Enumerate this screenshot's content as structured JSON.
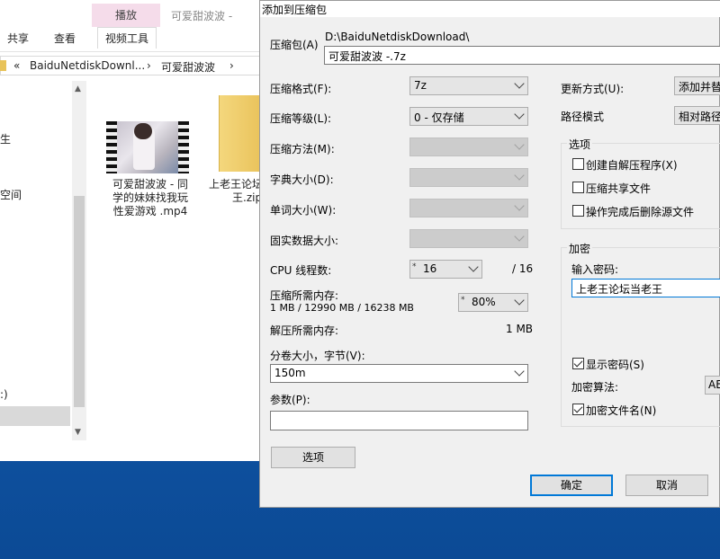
{
  "explorer": {
    "context_tab": "播放",
    "window_title": "可爱甜波波 -",
    "ribbon_tabs": [
      "共享",
      "查看",
      "视频工具"
    ],
    "breadcrumb": [
      "«",
      "BaiduNetdiskDownl...",
      "›",
      "可爱甜波波",
      "›"
    ],
    "nav_items": [
      "生",
      "空间",
      ":)"
    ],
    "files": [
      {
        "name_lines": [
          "可爱甜波波 - 同",
          "学的妹妹找我玩",
          "性爱游戏 .mp4"
        ]
      },
      {
        "name_lines": [
          "上老王论坛",
          "王.zip"
        ]
      }
    ]
  },
  "dialog": {
    "title": "添加到压缩包",
    "archive_label": "压缩包(A)",
    "archive_path": "D:\\BaiduNetdiskDownload\\",
    "archive_name": "可爱甜波波 -.7z",
    "format_label": "压缩格式(F):",
    "format_value": "7z",
    "level_label": "压缩等级(L):",
    "level_value": "0 - 仅存储",
    "method_label": "压缩方法(M):",
    "dict_label": "字典大小(D):",
    "word_label": "单词大小(W):",
    "solid_label": "固实数据大小:",
    "cpu_label": "CPU 线程数:",
    "cpu_value": "16",
    "cpu_total": "/ 16",
    "mem_comp_label": "压缩所需内存:",
    "mem_comp_detail": "1 MB / 12990 MB / 16238 MB",
    "mem_percent": "80%",
    "mem_decomp_label": "解压所需内存:",
    "mem_decomp_value": "1 MB",
    "volume_label": "分卷大小，字节(V):",
    "volume_value": "150m",
    "params_label": "参数(P):",
    "params_value": "",
    "options_button": "选项",
    "update_label": "更新方式(U):",
    "update_value": "添加并替",
    "path_label": "路径模式",
    "path_value": "相对路径",
    "options_group": "选项",
    "opt_sfx": "创建自解压程序(X)",
    "opt_shared": "压缩共享文件",
    "opt_delete": "操作完成后删除源文件",
    "encrypt_group": "加密",
    "password_label": "输入密码:",
    "password_value": "上老王论坛当老王",
    "show_password": "显示密码(S)",
    "enc_method_label": "加密算法:",
    "enc_method_value": "AE",
    "encrypt_names": "加密文件名(N)",
    "ok_button": "确定",
    "cancel_button": "取消"
  }
}
